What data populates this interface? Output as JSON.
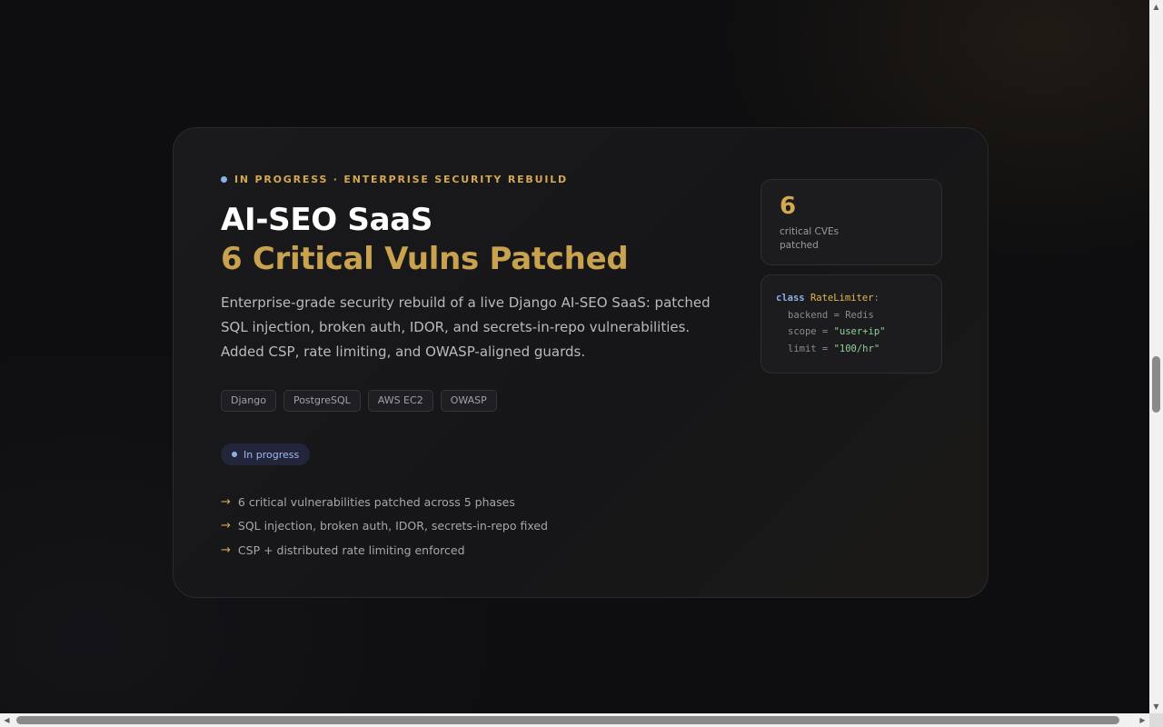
{
  "project": {
    "eyebrow": "In progress · Enterprise security rebuild",
    "title": "AI-SEO SaaS",
    "title_accent": "6 Critical Vulns Patched",
    "description": "Enterprise-grade security rebuild of a live Django AI-SEO SaaS: patched SQL injection, broken auth, IDOR, and secrets-in-repo vulnerabilities. Added CSP, rate limiting, and OWASP-aligned guards.",
    "tags": [
      "Django",
      "PostgreSQL",
      "AWS EC2",
      "OWASP"
    ],
    "status": "In progress",
    "highlights": [
      "6 critical vulnerabilities patched across 5 phases",
      "SQL injection, broken auth, IDOR, secrets-in-repo fixed",
      "CSP + distributed rate limiting enforced"
    ],
    "highlight_arrow": "→"
  },
  "stat": {
    "value": "6",
    "caption": "critical CVEs patched"
  },
  "code": {
    "keyword": "class",
    "class_name": "RateLimiter",
    "colon": ":",
    "lines": [
      {
        "attr": "backend",
        "op": " = ",
        "value": "Redis",
        "is_string": false
      },
      {
        "attr": "scope",
        "op": " = ",
        "value": "\"user+ip\"",
        "is_string": true
      },
      {
        "attr": "limit",
        "op": " = ",
        "value": "\"100/hr\"",
        "is_string": true
      }
    ]
  },
  "colors": {
    "accent_gold": "#c9a24f",
    "accent_blue": "#8fb0e6",
    "background": "#0e0e10",
    "card": "#18181b"
  },
  "icons": {
    "status_dot": "status-dot-icon",
    "arrow": "arrow-right-icon"
  },
  "scrollbar": {
    "up": "▲",
    "down": "▼",
    "left": "◀",
    "right": "▶"
  }
}
